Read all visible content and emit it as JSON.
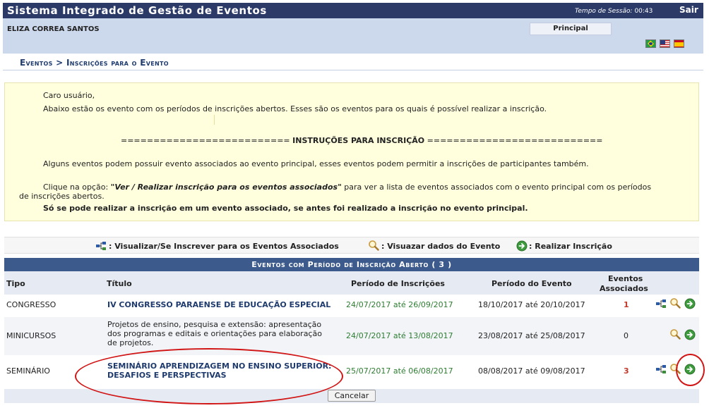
{
  "header": {
    "app_title": "Sistema Integrado de Gestão de Eventos",
    "session_label": "Tempo de Sessão:",
    "session_time": "00:43",
    "logout_label": "Sair"
  },
  "user": {
    "name": "ELIZA CORREA SANTOS",
    "principal_label": "Principal"
  },
  "breadcrumb": "Eventos > Inscrições para o Evento",
  "instructions": {
    "greeting": "Caro usuário,",
    "intro": "Abaixo estão os evento com os períodos de inscrições abertos. Esses são os eventos para os quais é possível realizar a inscrição.",
    "heading_left": "==========================",
    "heading": "INSTRUÇÕES PARA INSCRIÇÃO",
    "heading_right": "===========================",
    "associated_note": "Alguns eventos podem possuir evento associados ao evento principal, esses eventos podem permitir a inscrições de participantes também.",
    "option_prefix": "Clique na opção: ",
    "option_name": "\"Ver / Realizar inscrição para os eventos associados\"",
    "option_suffix": " para ver a lista de eventos associados com o evento principal com os períodos",
    "option_suffix_cont": "de inscrições abertos.",
    "rule": "Só se pode realizar a inscrição em um evento associado, se antes foi realizado a inscrição no evento principal."
  },
  "legend": {
    "associated": ": Visualizar/Se Inscrever para os Eventos Associados",
    "view": ": Visuazar dados do Evento",
    "register": ": Realizar Inscrição"
  },
  "table": {
    "caption": "Eventos com Período de Inscrição Aberto ( 3 )",
    "headers": {
      "tipo": "Tipo",
      "titulo": "Título",
      "periodo_inscricoes": "Período de Inscrições",
      "periodo_evento": "Período do Evento",
      "eventos_associados_1": "Eventos",
      "eventos_associados_2": "Associados"
    },
    "rows": [
      {
        "tipo": "CONGRESSO",
        "titulo": [
          "IV CONGRESSO PARAENSE DE EDUCAÇÃO ESPECIAL"
        ],
        "periodo_inscricoes": "24/07/2017 até 26/09/2017",
        "periodo_evento": "18/10/2017 até 20/10/2017",
        "associados": "1"
      },
      {
        "tipo": "MINICURSOS",
        "titulo": [
          "Projetos de ensino, pesquisa e extensão: apresentação",
          "dos programas e editais e orientações para elaboração",
          "de projetos."
        ],
        "periodo_inscricoes": "24/07/2017 até 13/08/2017",
        "periodo_evento": "23/08/2017 até 25/08/2017",
        "associados": "0"
      },
      {
        "tipo": "SEMINÁRIO",
        "titulo": [
          "SEMINÁRIO APRENDIZAGEM NO ENSINO SUPERIOR:",
          "DESAFIOS E PERSPECTIVAS"
        ],
        "periodo_inscricoes": "25/07/2017 até 06/08/2017",
        "periodo_evento": "08/08/2017 até 09/08/2017",
        "associados": "3"
      }
    ]
  },
  "footer": {
    "cancel_label": "Cancelar"
  },
  "colors": {
    "header_bg": "#2b3a67",
    "user_bar_bg": "#ccd8ec",
    "info_bg": "#ffffdd",
    "caption_bg": "#3c5a8c",
    "link": "#1f3b6e",
    "period_green": "#2e7d32",
    "count_red": "#c0392b",
    "annotation_red": "#d11414"
  },
  "icons": {
    "associated": "associated-events-icon",
    "view": "magnifier-icon",
    "register": "green-arrow-icon"
  }
}
